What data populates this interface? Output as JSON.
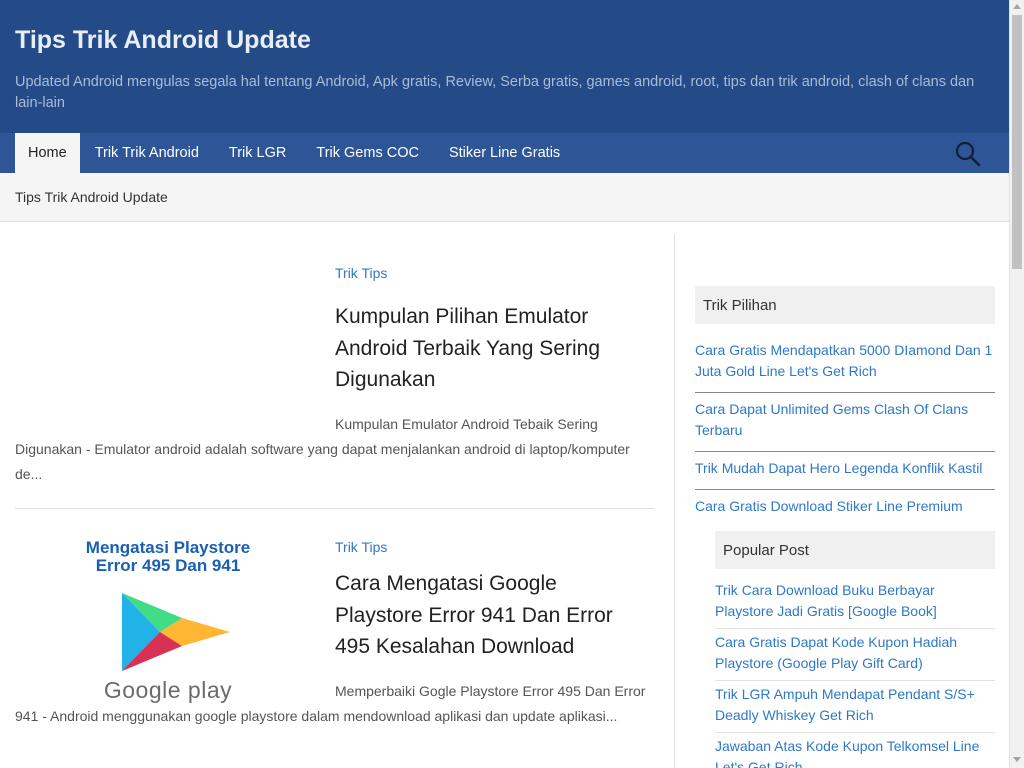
{
  "header": {
    "title": "Tips Trik Android Update",
    "description": "Updated Android mengulas segala hal tentang Android, Apk gratis, Review, Serba gratis, games android, root, tips dan trik android, clash of clans dan lain-lain"
  },
  "nav": {
    "items": [
      {
        "label": "Home",
        "active": true
      },
      {
        "label": "Trik Trik Android"
      },
      {
        "label": "Trik LGR"
      },
      {
        "label": "Trik Gems COC"
      },
      {
        "label": "Stiker Line Gratis"
      }
    ],
    "search_icon": "search-icon"
  },
  "breadcrumb": "Tips Trik Android Update",
  "posts": [
    {
      "category": "Trik Tips",
      "title": "Kumpulan Pilihan Emulator Android Terbaik Yang Sering Digunakan",
      "excerpt": "Kumpulan Emulator Android Tebaik Sering Digunakan - Emulator android adalah software yang dapat menjalankan android di laptop/komputer de..."
    },
    {
      "category": "Trik Tips",
      "title": "Cara Mengatasi Google Playstore Error 941 Dan Error 495 Kesalahan Download",
      "excerpt": "Memperbaiki Gogle Playstore Error 495 Dan Error 941 - Android menggunakan google playstore dalam mendownload aplikasi dan update aplikasi...",
      "thumb": {
        "heading_line1": "Mengatasi Playstore",
        "heading_line2": "Error 495 Dan 941",
        "logo_text": "Google play"
      }
    }
  ],
  "sidebar": {
    "trik_pilihan": {
      "heading": "Trik Pilihan",
      "items": [
        "Cara Gratis Mendapatkan 5000 DIamond Dan 1 Juta Gold Line Let's Get Rich",
        "Cara Dapat Unlimited Gems Clash Of Clans Terbaru",
        "Trik Mudah Dapat Hero Legenda Konflik Kastil",
        "Cara Gratis Download Stiker Line Premium"
      ]
    },
    "popular_post": {
      "heading": "Popular Post",
      "items": [
        "Trik Cara Download Buku Berbayar Playstore Jadi Gratis [Google Book]",
        "Cara Gratis Dapat Kode Kupon Hadiah Playstore (Google Play Gift Card)",
        "Trik LGR Ampuh Mendapat Pendant S/S+ Deadly Whiskey Get Rich",
        "Jawaban Atas Kode Kupon Telkomsel Line Let's Get Rich"
      ]
    }
  },
  "colors": {
    "header_bg": "#244a87",
    "nav_bg": "#2e5596",
    "link": "#2f78c6"
  }
}
